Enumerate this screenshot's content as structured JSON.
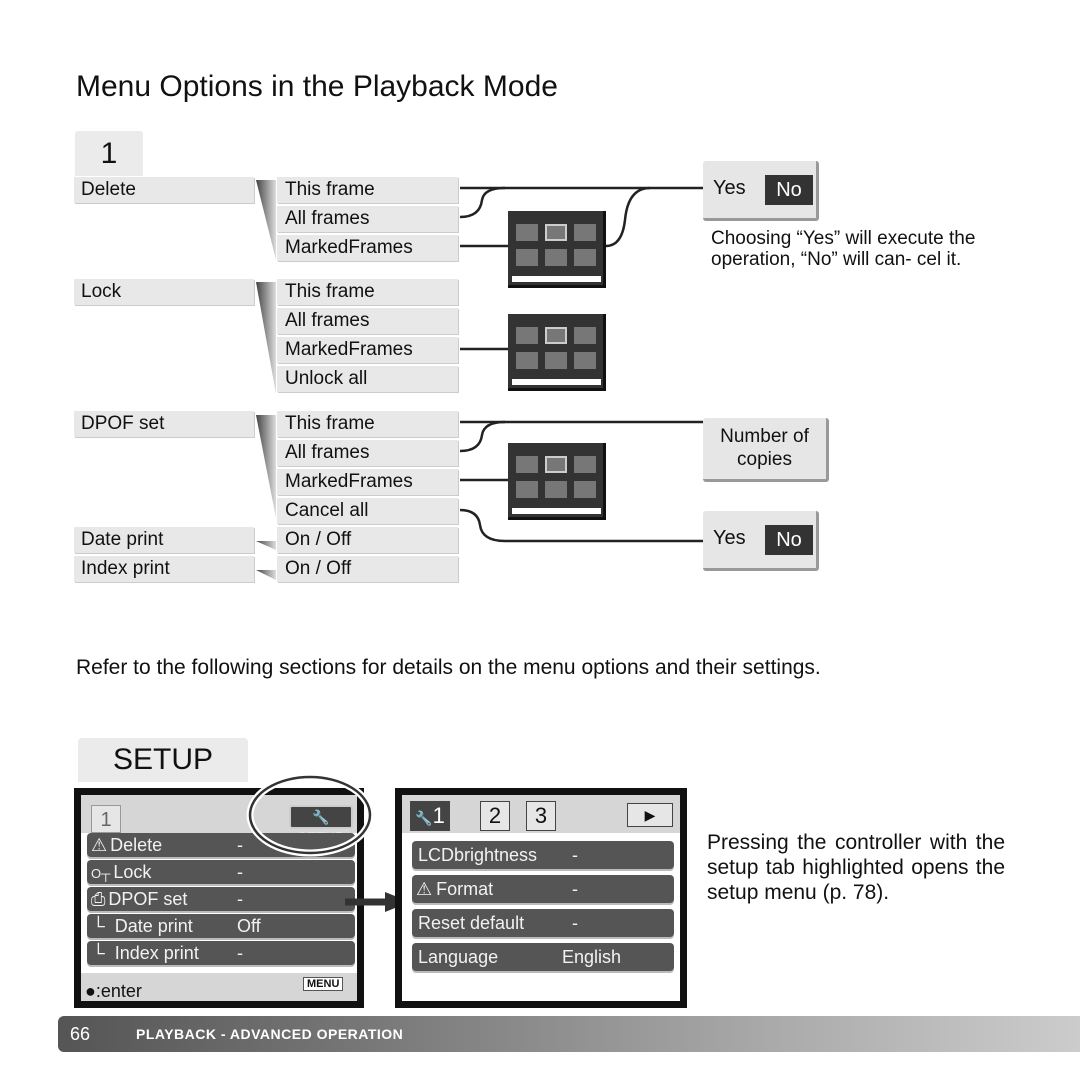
{
  "title": "Menu Options in the Playback Mode",
  "tab": "1",
  "menu": [
    {
      "label": "Delete",
      "options": [
        "This frame",
        "All frames",
        "MarkedFrames"
      ]
    },
    {
      "label": "Lock",
      "options": [
        "This frame",
        "All frames",
        "MarkedFrames",
        "Unlock all"
      ]
    },
    {
      "label": "DPOF set",
      "options": [
        "This frame",
        "All frames",
        "MarkedFrames",
        "Cancel all"
      ]
    },
    {
      "label": "Date print",
      "options": [
        "On / Off"
      ]
    },
    {
      "label": "Index print",
      "options": [
        "On / Off"
      ]
    }
  ],
  "confirm": {
    "yes": "Yes",
    "no": "No"
  },
  "note": "Choosing “Yes” will execute the operation, “No” will can- cel it.",
  "copies": "Number of copies",
  "refer": "Refer to the following sections for details on the menu options and their settings.",
  "setup_heading": "SETUP",
  "left_screen": {
    "tab": "1",
    "setup_tab": "SETUP",
    "rows": [
      {
        "label": "Delete",
        "value": "-"
      },
      {
        "label": "Lock",
        "value": "-"
      },
      {
        "label": "DPOF set",
        "value": "-"
      },
      {
        "label": "Date print",
        "value": "Off"
      },
      {
        "label": "Index print",
        "value": "-"
      }
    ],
    "enter": ":enter",
    "menu": "MENU"
  },
  "right_screen": {
    "tabs": [
      "1",
      "2",
      "3"
    ],
    "rows": [
      {
        "label": "LCDbrightness",
        "value": "-"
      },
      {
        "label": "Format",
        "value": "-"
      },
      {
        "label": "Reset default",
        "value": "-"
      },
      {
        "label": "Language",
        "value": "English"
      }
    ]
  },
  "pressing": "Pressing the controller with the setup tab highlighted opens the setup menu (p. 78).",
  "footer": {
    "page": "66",
    "section": "PLAYBACK - ADVANCED OPERATION"
  }
}
